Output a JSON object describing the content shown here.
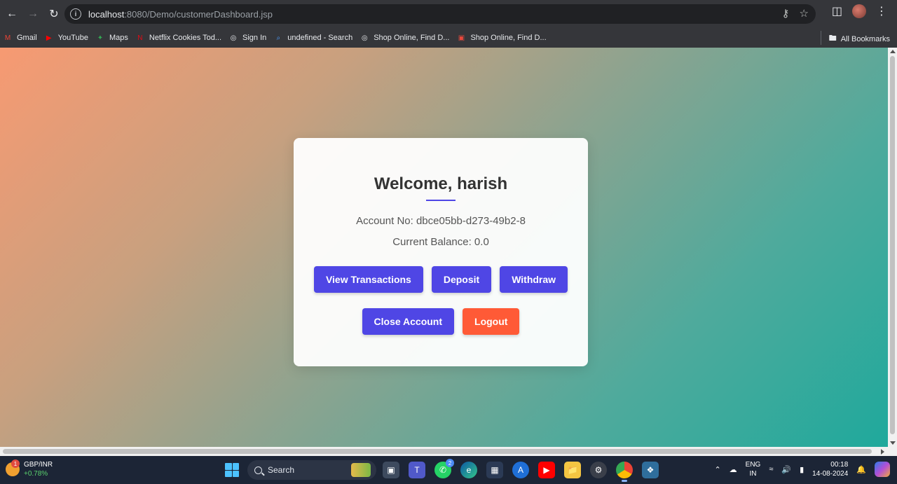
{
  "browser": {
    "url_host": "localhost",
    "url_rest": ":8080/Demo/customerDashboard.jsp",
    "bookmarks": [
      {
        "label": "Gmail",
        "icon": "gmail-icon",
        "color": "#ea4335"
      },
      {
        "label": "YouTube",
        "icon": "youtube-icon",
        "color": "#ff0000"
      },
      {
        "label": "Maps",
        "icon": "maps-icon",
        "color": "#34a853"
      },
      {
        "label": "Netflix Cookies Tod...",
        "icon": "netflix-icon",
        "color": "#e50914"
      },
      {
        "label": "Sign In",
        "icon": "globe-icon",
        "color": "#e8eaed"
      },
      {
        "label": "undefined - Search",
        "icon": "search-icon",
        "color": "#4b9bff"
      },
      {
        "label": "Shop Online, Find D...",
        "icon": "globe-icon",
        "color": "#e8eaed"
      },
      {
        "label": "Shop Online, Find D...",
        "icon": "shop-icon",
        "color": "#e8483c"
      }
    ],
    "all_bookmarks": "All Bookmarks"
  },
  "dashboard": {
    "title": "Welcome, harish",
    "account_no": "Account No: dbce05bb-d273-49b2-8",
    "balance": "Current Balance: 0.0",
    "buttons": {
      "view_transactions": "View Transactions",
      "deposit": "Deposit",
      "withdraw": "Withdraw",
      "close_account": "Close Account",
      "logout": "Logout"
    },
    "colors": {
      "primary": "#4f46e5",
      "danger": "#ff5a36"
    }
  },
  "taskbar": {
    "widget_title": "GBP/INR",
    "widget_change": "+0.78%",
    "widget_badge": "1",
    "search": "Search",
    "whatsapp_badge": "2",
    "lang_top": "ENG",
    "lang_bottom": "IN",
    "time": "00:18",
    "date": "14-08-2024"
  }
}
